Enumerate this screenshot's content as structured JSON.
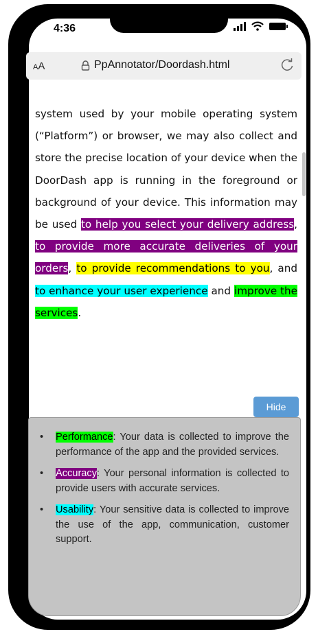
{
  "status_bar": {
    "time": "4:36"
  },
  "browser": {
    "text_size_label": "AA",
    "url": "PpAnnotator/Doordash.html"
  },
  "policy": {
    "p1": "system used by your mobile operating system (“Platform”) or browser, we may also collect and store the precise location of your device when the DoorDash app is running in the foreground or background of your device. This information may be used ",
    "h1": "to help you select your delivery address",
    "p2": ", ",
    "h2": "to provide more accurate deliveries of your orders",
    "p3": ", ",
    "h3": "to provide recommendations to you",
    "p4": ", and ",
    "h4": "to enhance your user experience",
    "p5": " and ",
    "h5": "improve the services",
    "p6": "."
  },
  "hide_button": "Hide",
  "legend": [
    {
      "tag": "Performance",
      "text": ": Your data is collected to improve the performance of the app and the provided services."
    },
    {
      "tag": "Accuracy",
      "text": ": Your personal information is collected to provide users with accurate services."
    },
    {
      "tag": "Usability",
      "text": ": Your sensitive data is collected to improve the use of the app, communication, customer support."
    }
  ],
  "colors": {
    "accuracy_purple": "#800080",
    "recommendation_yellow": "#ffff00",
    "usability_cyan": "#00ffff",
    "performance_green": "#00ff00",
    "hide_button_blue": "#5b9bd5"
  }
}
